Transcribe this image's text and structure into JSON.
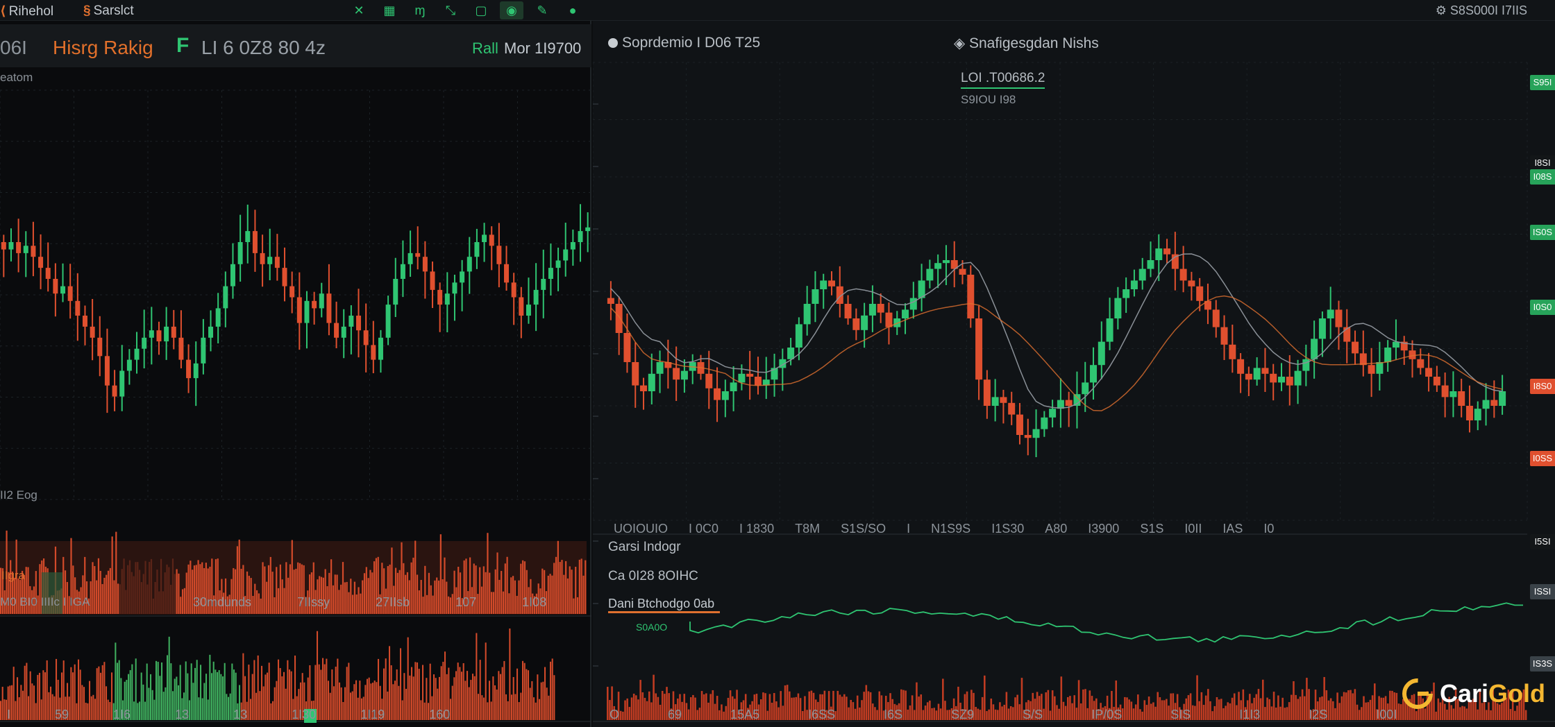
{
  "topbar": {
    "tabs": [
      {
        "icon": "doc-icon",
        "label": "Rihehol"
      },
      {
        "icon": "orange-s-icon",
        "label": "Sarslct"
      }
    ],
    "toolbar": [
      "crosshair-icon",
      "grid-icon",
      "measure-icon",
      "draw-line-icon",
      "rectangle-icon",
      "candle-type-icon",
      "pen-icon",
      "indicator-icon"
    ],
    "right_status": "S8S000I I7IIS"
  },
  "left_panel": {
    "code": "06I",
    "symbol": "Hisrg Rakig",
    "price_line": "LI 6 0Z8 80 4z",
    "mode": "Rall",
    "status": "Mor 1I9700",
    "top_label": "eatom",
    "volume_label": "II2 Eog",
    "volume_badge": "IIgra",
    "indicator_label": "M0 BI0 IIIIc I IGA",
    "bottom_axis_1": [
      "30mdunds",
      "7IIssy",
      "27IIsb",
      "107",
      "1I08"
    ],
    "bottom_axis_2": [
      "I",
      "59",
      "1I6",
      "13",
      "13",
      "1I30",
      "1I19",
      "160"
    ]
  },
  "right_panel": {
    "title_left": "Soprdemio I D06 T25",
    "title_right": "Snafigesgdan Nishs",
    "info_line_1": "LOI .T00686.2",
    "info_line_2": "S9IOU I98",
    "time_axis": [
      "UOIOUIO",
      "I 0C0",
      "I 1830",
      "T8M",
      "S1S/SO",
      "I",
      "N1S9S",
      "I1S30",
      "A80",
      "I3900",
      "S1S",
      "I0II",
      "IAS",
      "I0"
    ],
    "sub_title": "Garsi Indogr",
    "sub_value": "Ca 0I28 8OIHC",
    "legend": "Dani Btchodgo 0ab",
    "legend_sub": "S0A0O",
    "bottom_axis": [
      "O",
      "69",
      "15A5",
      "I6SS",
      "I6S",
      "SZ9",
      "S/S",
      "IP/0S",
      "SIS",
      "I1I3",
      "I2S",
      "I00I"
    ],
    "price_tags": [
      {
        "label": "S95I",
        "color": "#27a35a"
      },
      {
        "label": "I8SI",
        "color": "#131618"
      },
      {
        "label": "I08S",
        "color": "#27a35a"
      },
      {
        "label": "IS0S",
        "color": "#27a35a"
      },
      {
        "label": "I0S0",
        "color": "#27a35a"
      },
      {
        "label": "I8S0",
        "color": "#e0502f"
      },
      {
        "label": "I0SS",
        "color": "#e0502f"
      },
      {
        "label": "I5SI",
        "color": "#131618"
      },
      {
        "label": "ISSI",
        "color": "#3a4248"
      },
      {
        "label": "IS3S",
        "color": "#3a4248"
      }
    ]
  },
  "brand": {
    "part1": "Cari",
    "part2": "Gold"
  },
  "colors": {
    "up": "#2fc572",
    "down": "#e0502f",
    "accent": "#e0702f",
    "gold": "#f4b731"
  },
  "chart_data": [
    {
      "type": "candlestick",
      "panel": "left",
      "x": [
        1,
        2,
        3,
        4,
        5,
        6,
        7,
        8,
        9,
        10,
        11,
        12,
        13,
        14,
        15,
        16,
        17,
        18,
        19,
        20,
        21,
        22,
        23,
        24,
        25,
        26,
        27,
        28,
        29,
        30,
        31,
        32,
        33,
        34,
        35,
        36,
        37,
        38,
        39,
        40,
        41,
        42,
        43,
        44,
        45,
        46,
        47,
        48,
        49,
        50,
        51,
        52,
        53,
        54,
        55,
        56,
        57,
        58,
        59,
        60,
        61,
        62,
        63,
        64,
        65,
        66,
        67,
        68,
        69,
        70,
        71,
        72,
        73,
        74,
        75,
        76,
        77,
        78,
        79,
        80
      ],
      "series": [
        {
          "close": [
            0.68,
            0.7,
            0.67,
            0.69,
            0.66,
            0.63,
            0.6,
            0.56,
            0.58,
            0.54,
            0.5,
            0.47,
            0.44,
            0.39,
            0.31,
            0.28,
            0.35,
            0.38,
            0.41,
            0.44,
            0.46,
            0.43,
            0.47,
            0.44,
            0.38,
            0.33,
            0.37,
            0.44,
            0.47,
            0.52,
            0.58,
            0.64,
            0.7,
            0.73,
            0.67,
            0.64,
            0.66,
            0.63,
            0.58,
            0.55,
            0.48,
            0.54,
            0.52,
            0.56,
            0.48,
            0.44,
            0.47,
            0.5,
            0.46,
            0.42,
            0.38,
            0.44,
            0.53,
            0.6,
            0.64,
            0.67,
            0.66,
            0.62,
            0.57,
            0.53,
            0.56,
            0.59,
            0.62,
            0.66,
            0.7,
            0.72,
            0.69,
            0.64,
            0.59,
            0.55,
            0.5,
            0.53,
            0.57,
            0.6,
            0.63,
            0.65,
            0.68,
            0.7,
            0.73,
            0.74
          ]
        }
      ],
      "ylim": [
        0,
        1
      ]
    },
    {
      "type": "candlestick",
      "panel": "right",
      "x": [
        1,
        2,
        3,
        4,
        5,
        6,
        7,
        8,
        9,
        10,
        11,
        12,
        13,
        14,
        15,
        16,
        17,
        18,
        19,
        20,
        21,
        22,
        23,
        24,
        25,
        26,
        27,
        28,
        29,
        30,
        31,
        32,
        33,
        34,
        35,
        36,
        37,
        38,
        39,
        40,
        41,
        42,
        43,
        44,
        45,
        46,
        47,
        48,
        49,
        50,
        51,
        52,
        53,
        54,
        55,
        56,
        57,
        58,
        59,
        60,
        61,
        62,
        63,
        64,
        65,
        66,
        67,
        68,
        69,
        70,
        71,
        72,
        73,
        74,
        75,
        76,
        77,
        78,
        79,
        80,
        81,
        82,
        83,
        84,
        85,
        86,
        87,
        88,
        89,
        90,
        91,
        92,
        93,
        94,
        95,
        96,
        97,
        98,
        99,
        100,
        101,
        102,
        103,
        104,
        105,
        106,
        107,
        108,
        109,
        110
      ],
      "series": [
        {
          "close": [
            0.6,
            0.5,
            0.4,
            0.32,
            0.3,
            0.36,
            0.4,
            0.38,
            0.34,
            0.37,
            0.4,
            0.36,
            0.31,
            0.27,
            0.3,
            0.33,
            0.36,
            0.35,
            0.32,
            0.34,
            0.38,
            0.41,
            0.45,
            0.53,
            0.6,
            0.65,
            0.68,
            0.66,
            0.6,
            0.55,
            0.51,
            0.56,
            0.6,
            0.57,
            0.52,
            0.55,
            0.58,
            0.62,
            0.68,
            0.72,
            0.74,
            0.75,
            0.72,
            0.7,
            0.55,
            0.34,
            0.25,
            0.28,
            0.26,
            0.22,
            0.15,
            0.14,
            0.17,
            0.21,
            0.24,
            0.27,
            0.25,
            0.29,
            0.33,
            0.39,
            0.47,
            0.55,
            0.62,
            0.65,
            0.68,
            0.72,
            0.75,
            0.79,
            0.77,
            0.72,
            0.68,
            0.66,
            0.61,
            0.58,
            0.52,
            0.46,
            0.41,
            0.36,
            0.34,
            0.38,
            0.36,
            0.33,
            0.35,
            0.32,
            0.37,
            0.41,
            0.48,
            0.55,
            0.58,
            0.52,
            0.47,
            0.43,
            0.39,
            0.36,
            0.4,
            0.45,
            0.47,
            0.44,
            0.41,
            0.38,
            0.35,
            0.32,
            0.28,
            0.3,
            0.25,
            0.2,
            0.24,
            0.27,
            0.25,
            0.3
          ]
        }
      ],
      "ylim": [
        0,
        1
      ]
    }
  ]
}
